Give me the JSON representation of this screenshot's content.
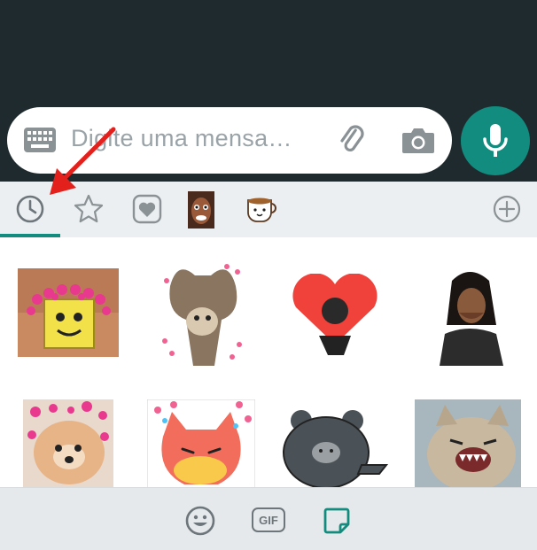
{
  "composer": {
    "placeholder": "Digite uma mensa…"
  },
  "icons": {
    "keyboard": "keyboard-icon",
    "attach": "paperclip-icon",
    "camera": "camera-icon",
    "mic": "microphone-icon",
    "recent": "clock-icon",
    "favorites": "star-icon",
    "add": "plus-icon",
    "emoji": "emoji-icon",
    "sticker": "sticker-icon"
  },
  "bottom": {
    "gif_label": "GIF"
  },
  "colors": {
    "accent": "#128c7e",
    "chat_background": "#1f2a2e",
    "tab_background": "#eceff1",
    "annotation_arrow": "#e3201b"
  }
}
